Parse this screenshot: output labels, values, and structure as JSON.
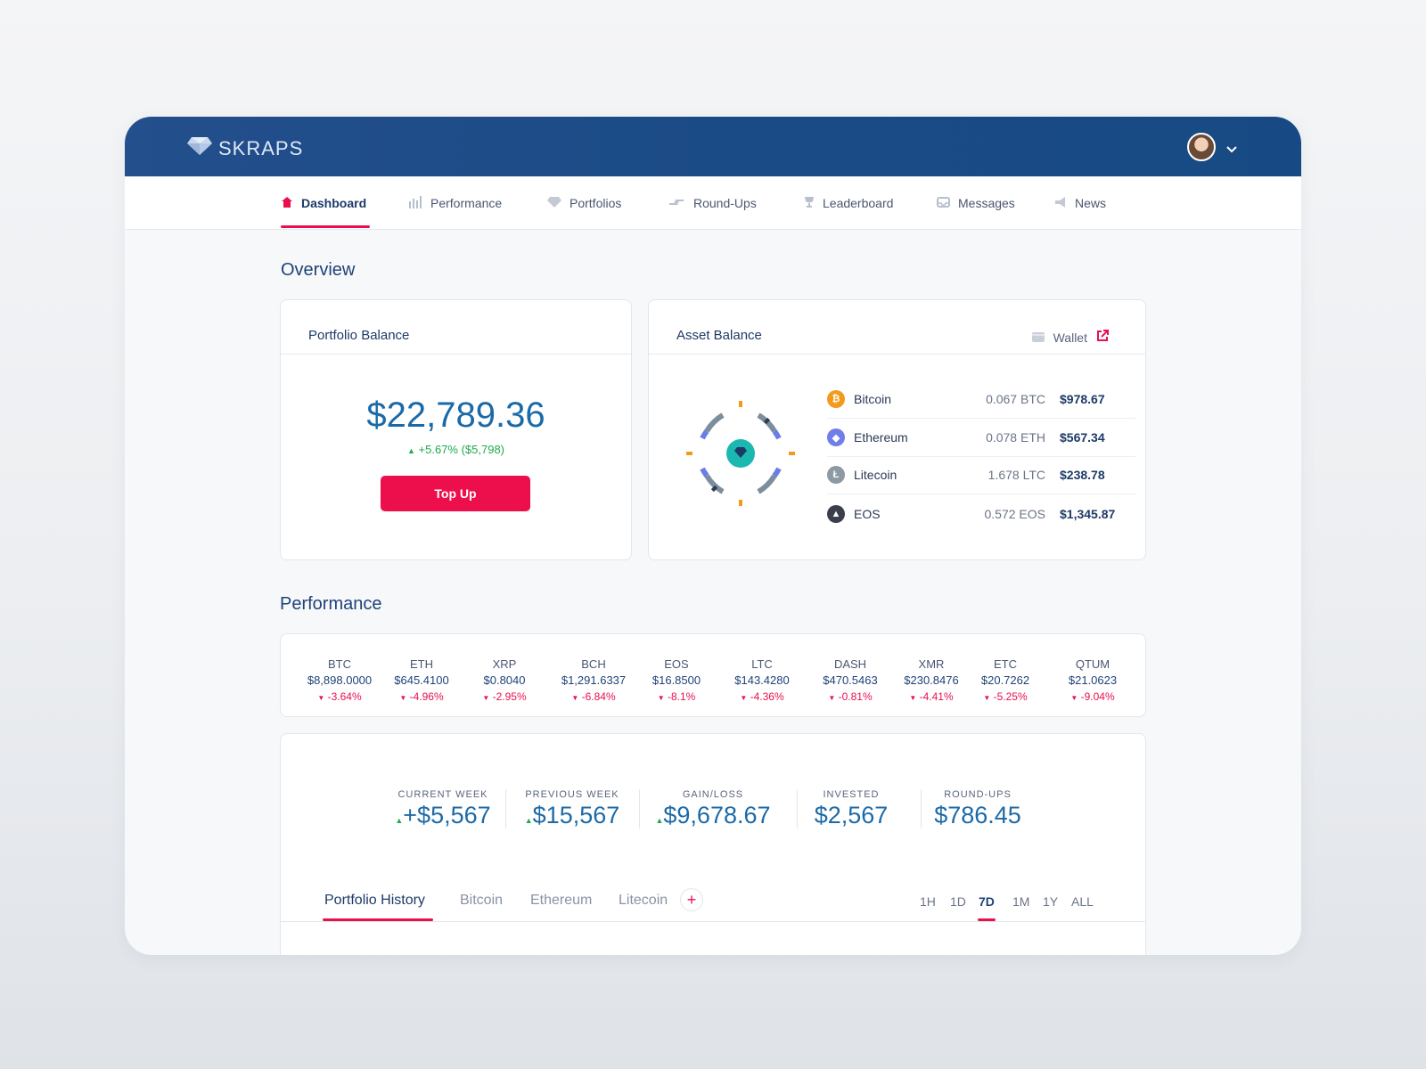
{
  "app": {
    "brand": "SKRAPS"
  },
  "nav": [
    {
      "label": "Dashboard",
      "icon": "home-icon"
    },
    {
      "label": "Performance",
      "icon": "bar-chart-icon"
    },
    {
      "label": "Portfolios",
      "icon": "diamond-icon"
    },
    {
      "label": "Round-Ups",
      "icon": "arrows-icon"
    },
    {
      "label": "Leaderboard",
      "icon": "trophy-icon"
    },
    {
      "label": "Messages",
      "icon": "inbox-icon"
    },
    {
      "label": "News",
      "icon": "megaphone-icon"
    }
  ],
  "overview": {
    "title": "Overview",
    "portfolio": {
      "title": "Portfolio Balance",
      "value": "$22,789.36",
      "change": "+5.67% ($5,798)",
      "button": "Top Up"
    },
    "assets": {
      "title": "Asset Balance",
      "wallet_label": "Wallet",
      "rows": [
        {
          "name": "Bitcoin",
          "amount": "0.067 BTC",
          "value": "$978.67",
          "color": "#f29a1c",
          "glyph": "₿"
        },
        {
          "name": "Ethereum",
          "amount": "0.078 ETH",
          "value": "$567.34",
          "color": "#6f7ee8",
          "glyph": "◆"
        },
        {
          "name": "Litecoin",
          "amount": "1.678 LTC",
          "value": "$238.78",
          "color": "#8d9aa4",
          "glyph": "Ł"
        },
        {
          "name": "EOS",
          "amount": "0.572 EOS",
          "value": "$1,345.87",
          "color": "#3a3f4a",
          "glyph": "▲"
        }
      ]
    }
  },
  "performance": {
    "title": "Performance",
    "tickers": [
      {
        "sym": "BTC",
        "price": "$8,898.0000",
        "chg": "-3.64%"
      },
      {
        "sym": "ETH",
        "price": "$645.4100",
        "chg": "-4.96%"
      },
      {
        "sym": "XRP",
        "price": "$0.8040",
        "chg": "-2.95%"
      },
      {
        "sym": "BCH",
        "price": "$1,291.6337",
        "chg": "-6.84%"
      },
      {
        "sym": "EOS",
        "price": "$16.8500",
        "chg": "-8.1%"
      },
      {
        "sym": "LTC",
        "price": "$143.4280",
        "chg": "-4.36%"
      },
      {
        "sym": "DASH",
        "price": "$470.5463",
        "chg": "-0.81%"
      },
      {
        "sym": "XMR",
        "price": "$230.8476",
        "chg": "-4.41%"
      },
      {
        "sym": "ETC",
        "price": "$20.7262",
        "chg": "-5.25%"
      },
      {
        "sym": "QTUM",
        "price": "$21.0623",
        "chg": "-9.04%"
      }
    ],
    "stats": [
      {
        "label": "CURRENT WEEK",
        "value": "+$5,567",
        "up": true
      },
      {
        "label": "PREVIOUS WEEK",
        "value": "$15,567",
        "up": true
      },
      {
        "label": "GAIN/LOSS",
        "value": "$9,678.67",
        "up": true
      },
      {
        "label": "INVESTED",
        "value": "$2,567",
        "up": false
      },
      {
        "label": "ROUND-UPS",
        "value": "$786.45",
        "up": false
      }
    ],
    "tabs": [
      "Portfolio History",
      "Bitcoin",
      "Ethereum",
      "Litecoin"
    ],
    "add_tab": "+",
    "ranges": [
      "1H",
      "1D",
      "7D",
      "1M",
      "1Y",
      "ALL"
    ],
    "active_range": "7D"
  },
  "colors": {
    "brand": "#1b4b86",
    "accent": "#e8104f",
    "up": "#1faa4a",
    "value": "#1b6aa8"
  }
}
